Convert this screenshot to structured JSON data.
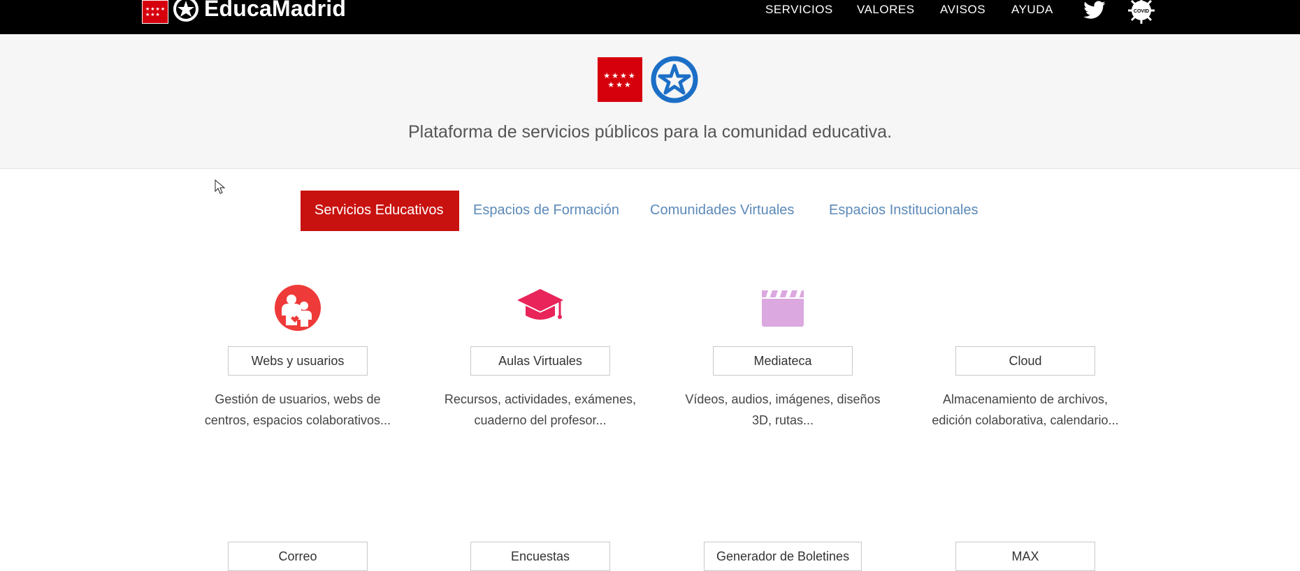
{
  "header": {
    "logo_text": "EducaMadrid",
    "nav": [
      "SERVICIOS",
      "VALORES",
      "AVISOS",
      "AYUDA"
    ],
    "icons": [
      "twitter-icon",
      "covid-icon"
    ]
  },
  "hero": {
    "tagline": "Plataforma de servicios públicos para la comunidad educativa."
  },
  "tabs": [
    {
      "label": "Servicios Educativos",
      "active": true
    },
    {
      "label": "Espacios de Formación",
      "active": false
    },
    {
      "label": "Comunidades Virtuales",
      "active": false
    },
    {
      "label": "Espacios Institucionales",
      "active": false
    }
  ],
  "services": [
    {
      "label": "Webs y usuarios",
      "desc1": "Gestión de usuarios, webs de",
      "desc2": "centros, espacios colaborativos...",
      "icon": "users-icon",
      "color": "#ee3a39"
    },
    {
      "label": "Aulas Virtuales",
      "desc1": "Recursos, actividades, exámenes,",
      "desc2": "cuaderno del profesor...",
      "icon": "graduation-cap-icon",
      "color": "#e8245a"
    },
    {
      "label": "Mediateca",
      "desc1": "Vídeos, audios, imágenes, diseños",
      "desc2": "3D, rutas...",
      "icon": "clapperboard-icon",
      "color": "#dba8e0"
    },
    {
      "label": "Cloud",
      "desc1": "Almacenamiento de archivos,",
      "desc2": "edición colaborativa, calendario...",
      "icon": "",
      "color": ""
    },
    {
      "label": "Correo"
    },
    {
      "label": "Encuestas"
    },
    {
      "label": "Generador de Boletines"
    },
    {
      "label": "MAX"
    }
  ]
}
